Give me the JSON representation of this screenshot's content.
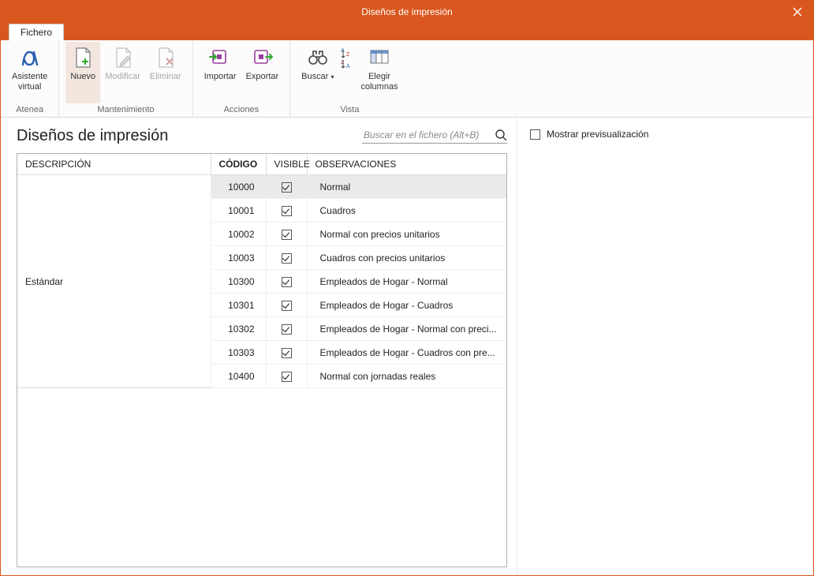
{
  "window": {
    "title": "Diseños de impresión"
  },
  "tab": {
    "fichero": "Fichero"
  },
  "ribbon": {
    "atenea": {
      "title": "Atenea",
      "asistente": "Asistente\nvirtual"
    },
    "mantenimiento": {
      "title": "Mantenimiento",
      "nuevo": "Nuevo",
      "modificar": "Modificar",
      "eliminar": "Eliminar"
    },
    "acciones": {
      "title": "Acciones",
      "importar": "Importar",
      "exportar": "Exportar"
    },
    "vista": {
      "title": "Vista",
      "buscar": "Buscar",
      "elegir": "Elegir\ncolumnas"
    }
  },
  "main": {
    "title": "Diseños de impresión",
    "search_placeholder": "Buscar en el fichero (Alt+B)"
  },
  "table": {
    "headers": {
      "descripcion": "DESCRIPCIÓN",
      "codigo": "CÓDIGO",
      "visible": "VISIBLE",
      "observaciones": "OBSERVACIONES"
    },
    "group_label": "Estándar",
    "rows": [
      {
        "code": "10000",
        "visible": true,
        "obs": "Normal",
        "selected": true
      },
      {
        "code": "10001",
        "visible": true,
        "obs": "Cuadros"
      },
      {
        "code": "10002",
        "visible": true,
        "obs": "Normal con precios unitarios"
      },
      {
        "code": "10003",
        "visible": true,
        "obs": "Cuadros con precios unitarios"
      },
      {
        "code": "10300",
        "visible": true,
        "obs": "Empleados de Hogar - Normal"
      },
      {
        "code": "10301",
        "visible": true,
        "obs": "Empleados de Hogar - Cuadros"
      },
      {
        "code": "10302",
        "visible": true,
        "obs": "Empleados de Hogar - Normal con preci..."
      },
      {
        "code": "10303",
        "visible": true,
        "obs": "Empleados de Hogar - Cuadros con pre..."
      },
      {
        "code": "10400",
        "visible": true,
        "obs": "Normal con jornadas reales"
      }
    ]
  },
  "right": {
    "preview": "Mostrar previsualización"
  }
}
